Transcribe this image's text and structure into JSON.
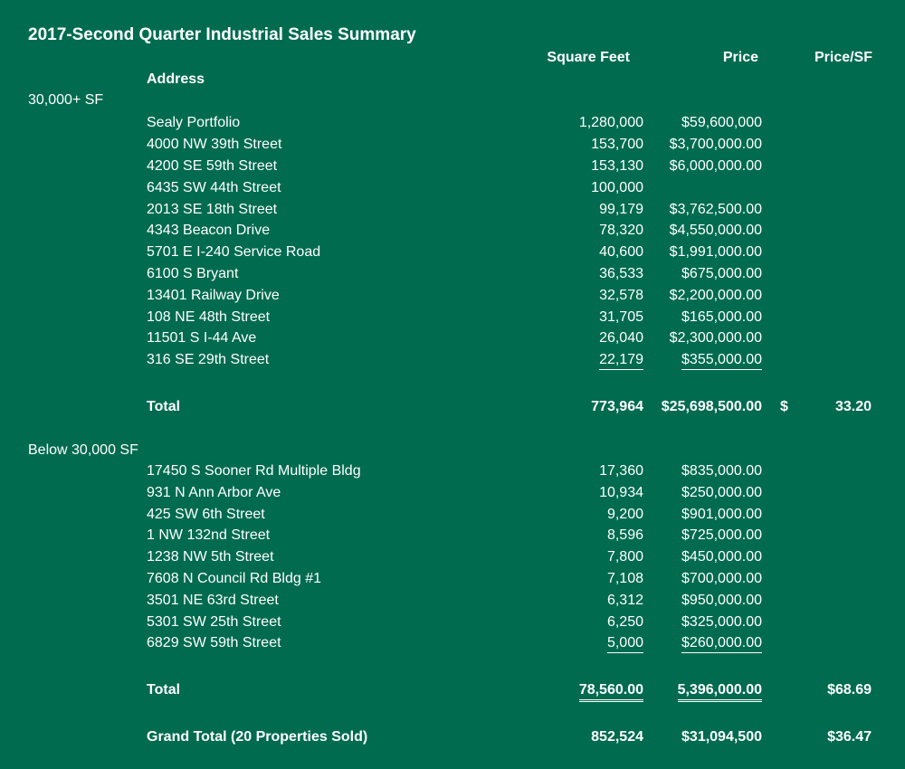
{
  "title": "2017-Second Quarter Industrial Sales Summary",
  "headers": {
    "address": "Address",
    "square_feet": "Square Feet",
    "price": "Price",
    "price_sf": "Price/SF"
  },
  "groups": [
    {
      "label": "30,000+ SF",
      "rows": [
        {
          "address": "Sealy Portfolio",
          "sf": "1,280,000",
          "price": "$59,600,000"
        },
        {
          "address": "4000 NW 39th Street",
          "sf": "153,700",
          "price": "$3,700,000.00"
        },
        {
          "address": "4200 SE 59th Street",
          "sf": "153,130",
          "price": "$6,000,000.00"
        },
        {
          "address": "6435 SW 44th Street",
          "sf": "100,000",
          "price": ""
        },
        {
          "address": "2013 SE 18th Street",
          "sf": "99,179",
          "price": "$3,762,500.00"
        },
        {
          "address": "4343 Beacon Drive",
          "sf": "78,320",
          "price": "$4,550,000.00"
        },
        {
          "address": "5701 E I-240 Service Road",
          "sf": "40,600",
          "price": "$1,991,000.00"
        },
        {
          "address": "6100 S Bryant",
          "sf": "36,533",
          "price": "$675,000.00"
        },
        {
          "address": "13401 Railway Drive",
          "sf": "32,578",
          "price": "$2,200,000.00"
        },
        {
          "address": "108 NE 48th Street",
          "sf": "31,705",
          "price": "$165,000.00"
        },
        {
          "address": "11501 S I-44 Ave",
          "sf": "26,040",
          "price": "$2,300,000.00"
        },
        {
          "address": "316 SE 29th Street",
          "sf": "22,179",
          "price": "$355,000.00"
        }
      ],
      "total": {
        "label": "Total",
        "sf": "773,964",
        "price": "$25,698,500.00",
        "dollar": "$",
        "psf": "33.20"
      }
    },
    {
      "label": "Below 30,000 SF",
      "rows": [
        {
          "address": "17450 S Sooner Rd Multiple Bldg",
          "sf": "17,360",
          "price": "$835,000.00"
        },
        {
          "address": "931 N Ann Arbor Ave",
          "sf": "10,934",
          "price": "$250,000.00"
        },
        {
          "address": "425 SW 6th Street",
          "sf": "9,200",
          "price": "$901,000.00"
        },
        {
          "address": "1 NW 132nd Street",
          "sf": "8,596",
          "price": "$725,000.00"
        },
        {
          "address": "1238 NW 5th Street",
          "sf": "7,800",
          "price": "$450,000.00"
        },
        {
          "address": "7608 N Council Rd Bldg #1",
          "sf": "7,108",
          "price": "$700,000.00"
        },
        {
          "address": "3501 NE 63rd Street",
          "sf": "6,312",
          "price": "$950,000.00"
        },
        {
          "address": "5301 SW 25th Street",
          "sf": "6,250",
          "price": "$325,000.00"
        },
        {
          "address": "6829 SW 59th Street",
          "sf": "5,000",
          "price": "$260,000.00"
        }
      ],
      "total": {
        "label": "Total",
        "sf": "78,560.00",
        "price": "5,396,000.00",
        "dollar": "",
        "psf": "$68.69"
      }
    }
  ],
  "grand_total": {
    "label": "Grand Total (20 Properties Sold)",
    "sf": "852,524",
    "price": "$31,094,500",
    "psf": "$36.47"
  }
}
